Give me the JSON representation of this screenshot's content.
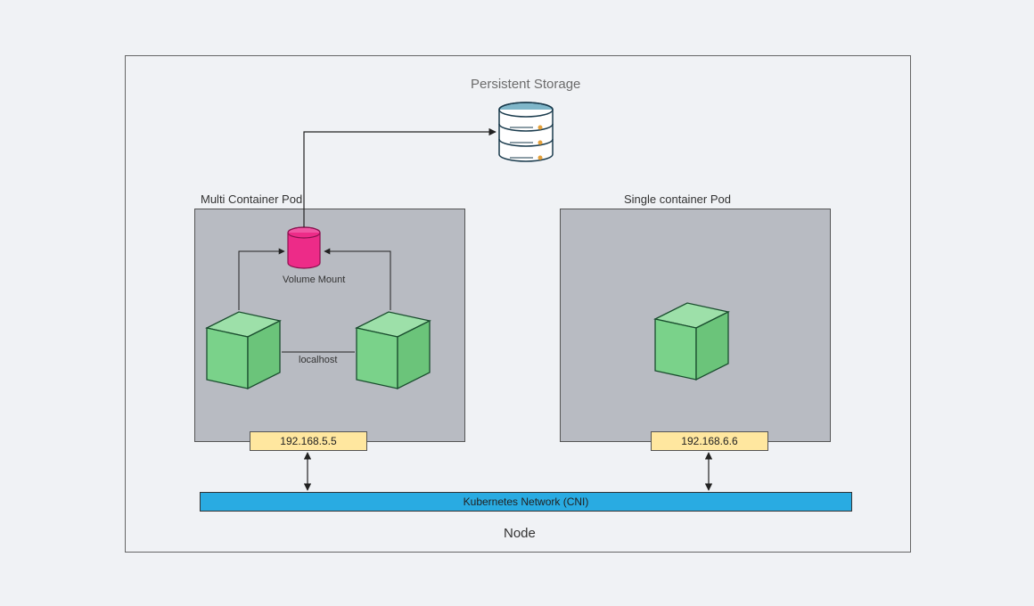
{
  "title": "Persistent Storage",
  "node_label": "Node",
  "cni_label": "Kubernetes Network (CNI)",
  "pods": {
    "multi": {
      "title": "Multi Container Pod",
      "ip": "192.168.5.5",
      "volume_label": "Volume Mount",
      "link_label": "localhost"
    },
    "single": {
      "title": "Single container Pod",
      "ip": "192.168.6.6"
    }
  },
  "colors": {
    "pod_fill": "#b8bbc2",
    "ip_fill": "#ffe79f",
    "cni_fill": "#29abe2",
    "cube_fill": "#7ad28a",
    "cube_stroke": "#1a4d2e",
    "volume_fill": "#ed2b88",
    "db_top": "#7fb6c9",
    "db_body": "#ffffff"
  }
}
